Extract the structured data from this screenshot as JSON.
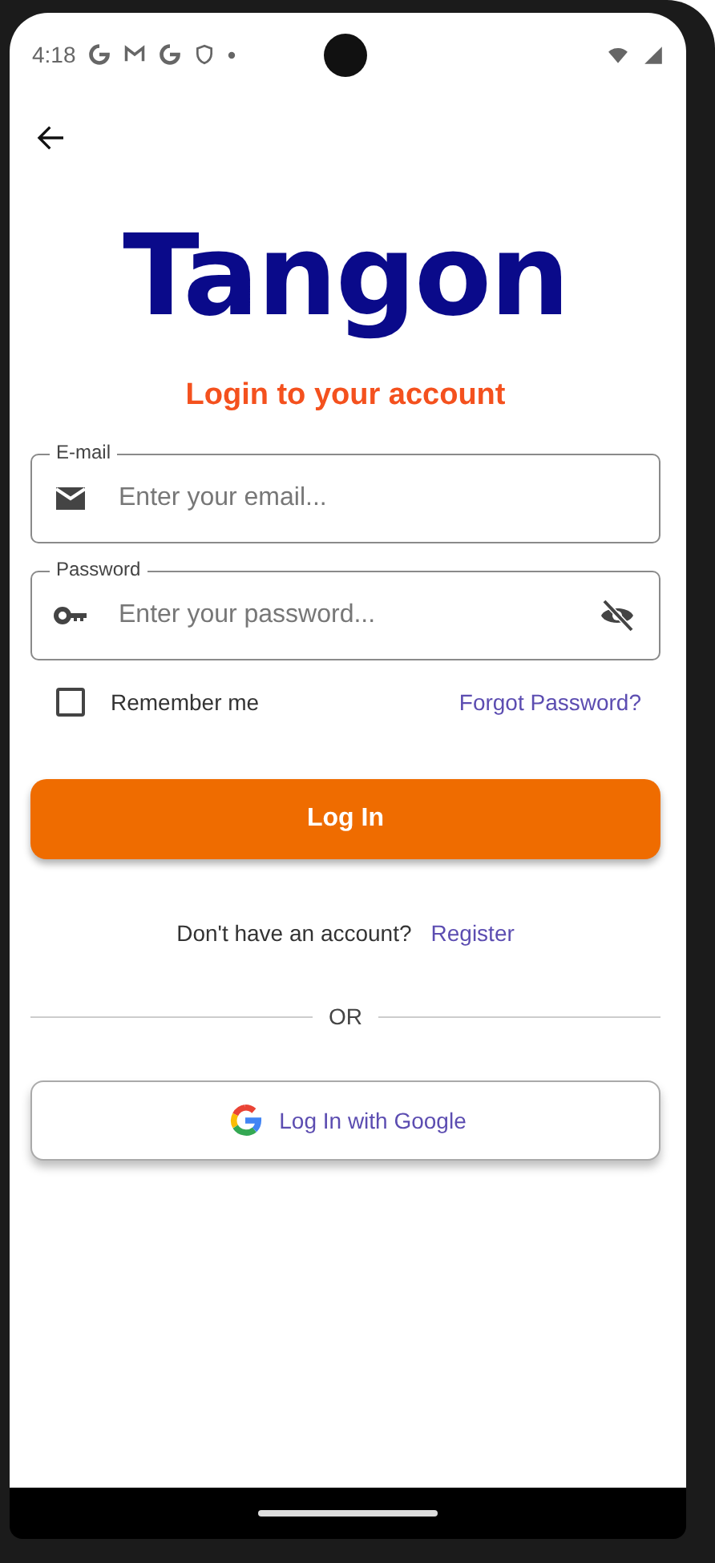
{
  "status_bar": {
    "time": "4:18"
  },
  "app": {
    "logo": "Tangon",
    "heading": "Login to your account"
  },
  "fields": [
    {
      "kind": "email",
      "label": "E-mail",
      "placeholder": "Enter your email..."
    },
    {
      "kind": "password",
      "label": "Password",
      "placeholder": "Enter your password..."
    }
  ],
  "remember": {
    "label": "Remember me",
    "checked": false
  },
  "forgot_link": "Forgot Password?",
  "login_button": "Log In",
  "register": {
    "prompt": "Don't have an account?",
    "link": "Register"
  },
  "divider": "OR",
  "google_button": "Log In with Google"
}
